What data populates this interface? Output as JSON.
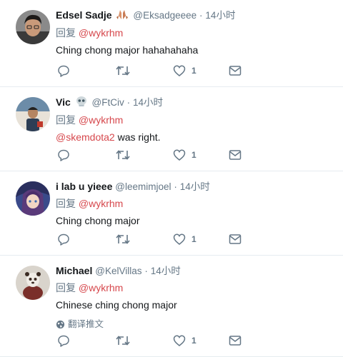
{
  "colors": {
    "accent": "#d6474c",
    "muted": "#657786",
    "divider": "#e6ecf0"
  },
  "tweets": [
    {
      "name": "Edsel Sadje",
      "handle": "@Eksadgeeee",
      "time": "14小时",
      "reply_prefix": "回复",
      "reply_to": "@wykrhm",
      "text": "Ching chong major hahahahaha",
      "like_count": "1",
      "icons": [
        "avatar",
        "praying-hands-emoji",
        "reply-icon",
        "retweet-icon",
        "heart-icon",
        "message-icon"
      ]
    },
    {
      "name": "Vic",
      "handle": "@FtCiv",
      "time": "14小时",
      "reply_prefix": "回复",
      "reply_to": "@wykrhm",
      "mention": "@skemdota2",
      "text": " was right.",
      "like_count": "1",
      "icons": [
        "avatar",
        "skull-emoji",
        "reply-icon",
        "retweet-icon",
        "heart-icon",
        "message-icon"
      ]
    },
    {
      "name": "i lab u yieee",
      "handle": "@leemimjoel",
      "time": "14小时",
      "reply_prefix": "回复",
      "reply_to": "@wykrhm",
      "text": "Ching chong major",
      "like_count": "1",
      "icons": [
        "avatar",
        "reply-icon",
        "retweet-icon",
        "heart-icon",
        "message-icon"
      ]
    },
    {
      "name": "Michael",
      "handle": "@KelVillas",
      "time": "14小时",
      "reply_prefix": "回复",
      "reply_to": "@wykrhm",
      "text": "Chinese ching chong major",
      "translate": "翻译推文",
      "like_count": "1",
      "icons": [
        "avatar",
        "globe-icon",
        "reply-icon",
        "retweet-icon",
        "heart-icon",
        "message-icon"
      ]
    }
  ]
}
